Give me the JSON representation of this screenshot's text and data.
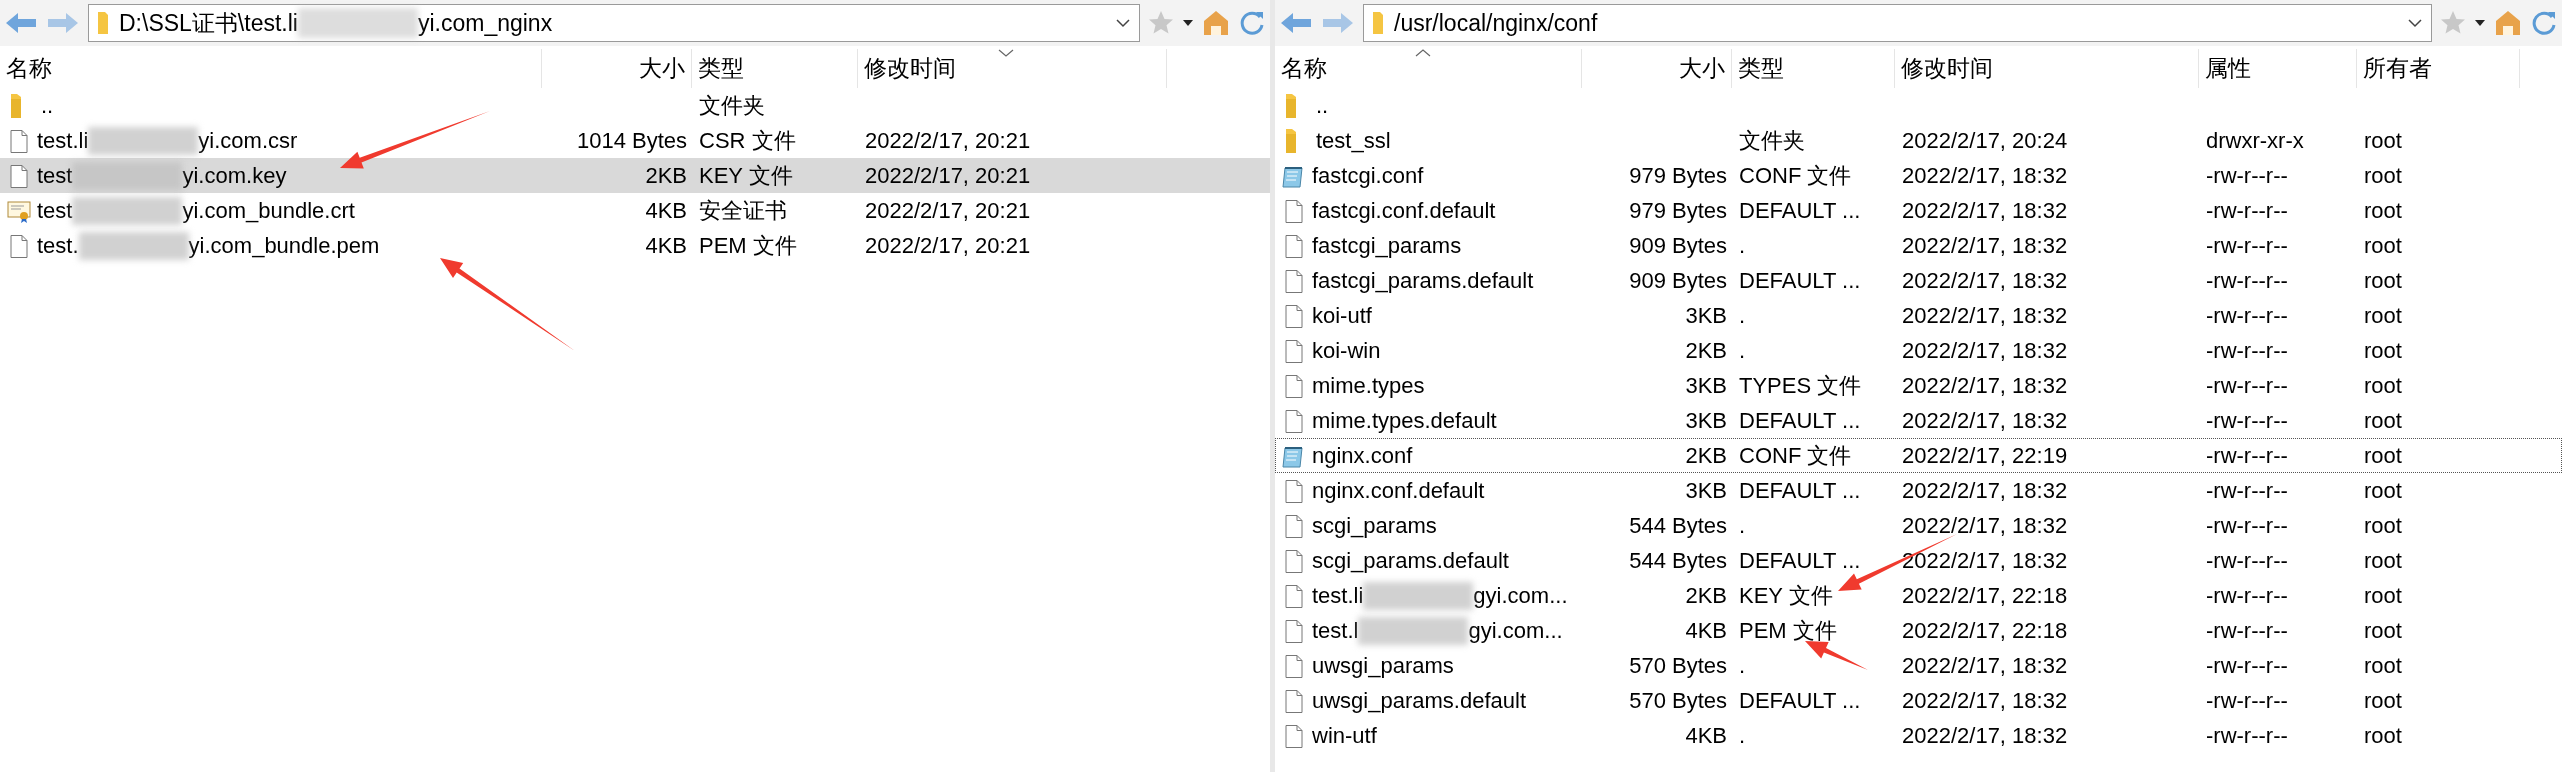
{
  "panes": [
    {
      "path": "D:\\SSL证书\\test.li",
      "path_tail": "yi.com_nginx",
      "columns": [
        {
          "label": "名称",
          "sorted": false
        },
        {
          "label": "大小",
          "sorted": false
        },
        {
          "label": "类型",
          "sorted": false
        },
        {
          "label": "修改时间",
          "sorted": true,
          "ascending": false
        }
      ],
      "rows": [
        {
          "kind": "parent",
          "name": [
            ".."
          ],
          "type": "文件夹",
          "selected": false,
          "focused": false
        },
        {
          "kind": "file",
          "name": [
            "test.li",
            "yi.com.csr"
          ],
          "size": "1014 Bytes",
          "type": "CSR 文件",
          "modified": "2022/2/17, 20:21",
          "selected": false,
          "focused": false
        },
        {
          "kind": "file",
          "name": [
            "test",
            "yi.com.key"
          ],
          "size": "2KB",
          "type": "KEY 文件",
          "modified": "2022/2/17, 20:21",
          "selected": true,
          "focused": false
        },
        {
          "kind": "cert",
          "name": [
            "test",
            "yi.com_bundle.crt"
          ],
          "size": "4KB",
          "type": "安全证书",
          "modified": "2022/2/17, 20:21",
          "selected": false,
          "focused": false
        },
        {
          "kind": "file",
          "name": [
            "test.",
            "yi.com_bundle.pem"
          ],
          "size": "4KB",
          "type": "PEM 文件",
          "modified": "2022/2/17, 20:21",
          "selected": false,
          "focused": false
        }
      ]
    },
    {
      "path": "/usr/local/nginx/conf",
      "columns": [
        {
          "label": "名称",
          "sorted": true,
          "ascending": true
        },
        {
          "label": "大小",
          "sorted": false
        },
        {
          "label": "类型",
          "sorted": false
        },
        {
          "label": "修改时间",
          "sorted": false
        },
        {
          "label": "属性",
          "sorted": false
        },
        {
          "label": "所有者",
          "sorted": false
        }
      ],
      "rows": [
        {
          "kind": "parent",
          "name": [
            ".."
          ],
          "selected": false,
          "focused": false
        },
        {
          "kind": "folder",
          "name": [
            "test_ssl"
          ],
          "type": "文件夹",
          "modified": "2022/2/17, 20:24",
          "attributes": "drwxr-xr-x",
          "owner": "root",
          "selected": false,
          "focused": false
        },
        {
          "kind": "conf",
          "name": [
            "fastcgi.conf"
          ],
          "size": "979 Bytes",
          "type": "CONF 文件",
          "modified": "2022/2/17, 18:32",
          "attributes": "-rw-r--r--",
          "owner": "root",
          "selected": false,
          "focused": false
        },
        {
          "kind": "file",
          "name": [
            "fastcgi.conf.default"
          ],
          "size": "979 Bytes",
          "type": "DEFAULT ...",
          "modified": "2022/2/17, 18:32",
          "attributes": "-rw-r--r--",
          "owner": "root",
          "selected": false,
          "focused": false
        },
        {
          "kind": "file",
          "name": [
            "fastcgi_params"
          ],
          "size": "909 Bytes",
          "type": ".",
          "modified": "2022/2/17, 18:32",
          "attributes": "-rw-r--r--",
          "owner": "root",
          "selected": false,
          "focused": false
        },
        {
          "kind": "file",
          "name": [
            "fastcgi_params.default"
          ],
          "size": "909 Bytes",
          "type": "DEFAULT ...",
          "modified": "2022/2/17, 18:32",
          "attributes": "-rw-r--r--",
          "owner": "root",
          "selected": false,
          "focused": false
        },
        {
          "kind": "file",
          "name": [
            "koi-utf"
          ],
          "size": "3KB",
          "type": ".",
          "modified": "2022/2/17, 18:32",
          "attributes": "-rw-r--r--",
          "owner": "root",
          "selected": false,
          "focused": false
        },
        {
          "kind": "file",
          "name": [
            "koi-win"
          ],
          "size": "2KB",
          "type": ".",
          "modified": "2022/2/17, 18:32",
          "attributes": "-rw-r--r--",
          "owner": "root",
          "selected": false,
          "focused": false
        },
        {
          "kind": "file",
          "name": [
            "mime.types"
          ],
          "size": "3KB",
          "type": "TYPES 文件",
          "modified": "2022/2/17, 18:32",
          "attributes": "-rw-r--r--",
          "owner": "root",
          "selected": false,
          "focused": false
        },
        {
          "kind": "file",
          "name": [
            "mime.types.default"
          ],
          "size": "3KB",
          "type": "DEFAULT ...",
          "modified": "2022/2/17, 18:32",
          "attributes": "-rw-r--r--",
          "owner": "root",
          "selected": false,
          "focused": false
        },
        {
          "kind": "conf",
          "name": [
            "nginx.conf"
          ],
          "size": "2KB",
          "type": "CONF 文件",
          "modified": "2022/2/17, 22:19",
          "attributes": "-rw-r--r--",
          "owner": "root",
          "selected": false,
          "focused": true
        },
        {
          "kind": "file",
          "name": [
            "nginx.conf.default"
          ],
          "size": "3KB",
          "type": "DEFAULT ...",
          "modified": "2022/2/17, 18:32",
          "attributes": "-rw-r--r--",
          "owner": "root",
          "selected": false,
          "focused": false
        },
        {
          "kind": "file",
          "name": [
            "scgi_params"
          ],
          "size": "544 Bytes",
          "type": ".",
          "modified": "2022/2/17, 18:32",
          "attributes": "-rw-r--r--",
          "owner": "root",
          "selected": false,
          "focused": false
        },
        {
          "kind": "file",
          "name": [
            "scgi_params.default"
          ],
          "size": "544 Bytes",
          "type": "DEFAULT ...",
          "modified": "2022/2/17, 18:32",
          "attributes": "-rw-r--r--",
          "owner": "root",
          "selected": false,
          "focused": false
        },
        {
          "kind": "file",
          "name": [
            "test.li",
            "gyi.com..."
          ],
          "size": "2KB",
          "type": "KEY 文件",
          "modified": "2022/2/17, 22:18",
          "attributes": "-rw-r--r--",
          "owner": "root",
          "selected": false,
          "focused": false
        },
        {
          "kind": "file",
          "name": [
            "test.l",
            "gyi.com..."
          ],
          "size": "4KB",
          "type": "PEM 文件",
          "modified": "2022/2/17, 22:18",
          "attributes": "-rw-r--r--",
          "owner": "root",
          "selected": false,
          "focused": false
        },
        {
          "kind": "file",
          "name": [
            "uwsgi_params"
          ],
          "size": "570 Bytes",
          "type": ".",
          "modified": "2022/2/17, 18:32",
          "attributes": "-rw-r--r--",
          "owner": "root",
          "selected": false,
          "focused": false
        },
        {
          "kind": "file",
          "name": [
            "uwsgi_params.default"
          ],
          "size": "570 Bytes",
          "type": "DEFAULT ...",
          "modified": "2022/2/17, 18:32",
          "attributes": "-rw-r--r--",
          "owner": "root",
          "selected": false,
          "focused": false
        },
        {
          "kind": "file",
          "name": [
            "win-utf"
          ],
          "size": "4KB",
          "type": ".",
          "modified": "2022/2/17, 18:32",
          "attributes": "-rw-r--r--",
          "owner": "root",
          "selected": false,
          "focused": false
        }
      ]
    }
  ]
}
